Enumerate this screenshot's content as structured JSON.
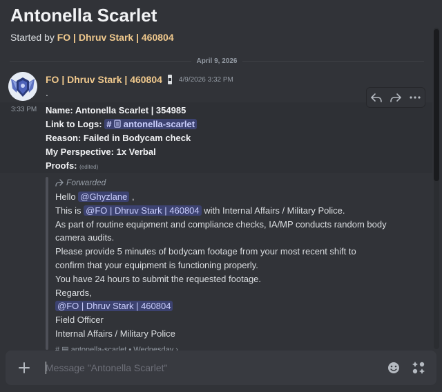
{
  "thread": {
    "title": "Antonella Scarlet",
    "started_by_prefix": "Started by ",
    "started_by_author": "FO | Dhruv Stark | 460804"
  },
  "date_divider": "April 9, 2026",
  "message": {
    "author": "FO | Dhruv Stark | 460804",
    "timestamp": "4/9/2026 3:32 PM",
    "first_line": ".",
    "side_time": "3:33 PM",
    "fields": [
      {
        "label": "Name:",
        "value": " Antonella Scarlet  | 354985"
      },
      {
        "label": "Link to Logs:",
        "channel_hash": "#",
        "channel": "antonella-scarlet"
      },
      {
        "label": "Reason:",
        "value": " Failed in Bodycam check"
      },
      {
        "label": "My Perspective:",
        "value": " 1x Verbal"
      },
      {
        "label": "Proofs:",
        "edited": "(edited)"
      }
    ]
  },
  "forwarded": {
    "label": "Forwarded",
    "hello": "Hello ",
    "mention_user": "@Ghyzlane",
    "comma": " ,",
    "this_is": "This is ",
    "mention_fo": "@FO | Dhruv Stark | 460804",
    "with": " with Internal Affairs / Military Police.",
    "line3": "As part of routine equipment and compliance checks, IA/MP conducts random body",
    "line4": "camera audits.",
    "line5": "Please provide 5 minutes of bodycam footage from your most recent shift to",
    "line6": "confirm that your equipment is functioning properly.",
    "line7": "You have 24 hours to submit the requested footage.",
    "line8": "Regards,",
    "mention_sign": "@FO | Dhruv Stark | 460804",
    "line10": "Field Officer",
    "line11": "Internal Affairs / Military Police",
    "source": "# ▤ antonella-scarlet • Wednesday ›"
  },
  "composer": {
    "placeholder": "Message \"Antonella Scarlet\""
  },
  "colors": {
    "background": "#313338",
    "author": "#f0c98d",
    "mention_bg": "#3c4270",
    "mention_text": "#c9cdfb"
  }
}
